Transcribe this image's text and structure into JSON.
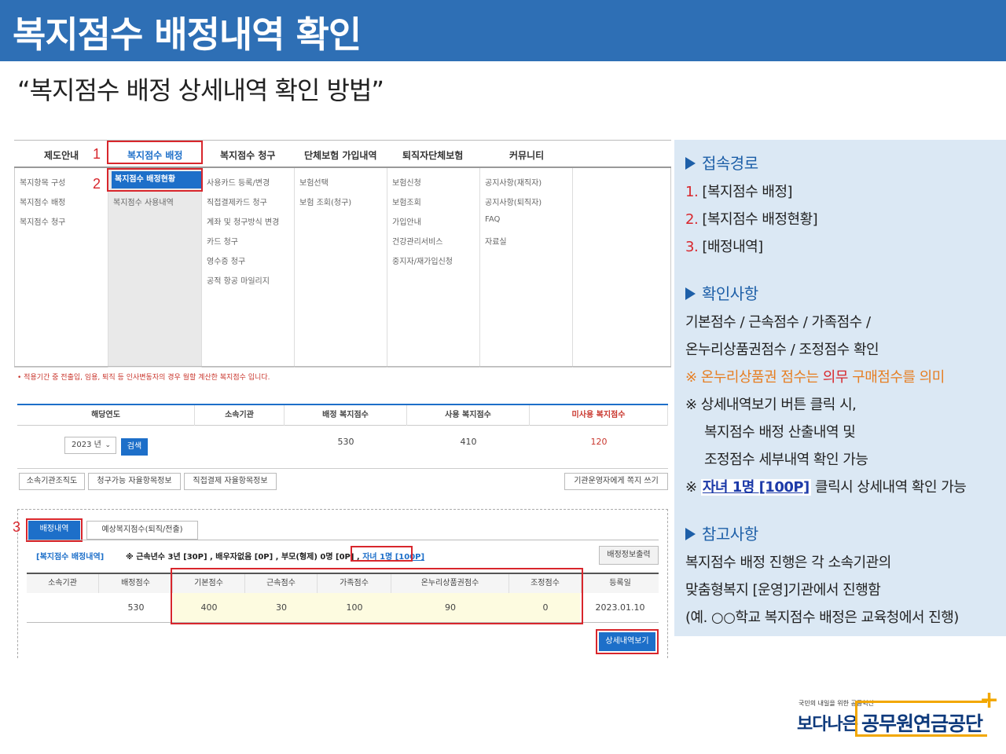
{
  "title": "복지점수 배정내역 확인",
  "subtitle": "“복지점수 배정 상세내역 확인 방법”",
  "screenshot": {
    "nav": [
      "제도안내",
      "복지점수 배정",
      "복지점수 청구",
      "단체보험 가입내역",
      "퇴직자단체보험",
      "커뮤니티"
    ],
    "step_numbers": [
      "1",
      "2",
      "3"
    ],
    "menu_col1": [
      "복지항목 구성",
      "복지점수 배정",
      "복지점수 청구"
    ],
    "menu_col2": [
      "복지점수 배정현황",
      "복지점수 사용내역"
    ],
    "menu_col3": [
      "사용카드 등록/변경",
      "직접결제카드 청구",
      "계좌 및 청구방식 변경",
      "카드 청구",
      "영수증 청구",
      "공적 항공 마일리지"
    ],
    "menu_col4": [
      "보험선택",
      "보험 조회(청구)"
    ],
    "menu_col5": [
      "보험신청",
      "보험조회",
      "가입안내",
      "건강관리서비스",
      "중지자/재가입신청"
    ],
    "menu_col6": [
      "공지사항(재직자)",
      "공지사항(퇴직자)",
      "FAQ",
      "자료실"
    ],
    "notice": "• 적용기간 중 전출입, 임용, 퇴직 등 인사변동자의 경우 월할 계산한 복지점수 입니다.",
    "year_table": {
      "headers": [
        "해당연도",
        "소속기관",
        "배정 복지점수",
        "사용 복지점수",
        "미사용 복지점수"
      ],
      "year": "2023 년",
      "search": "검색",
      "assigned": "530",
      "used": "410",
      "unused": "120"
    },
    "buttons": [
      "소속기관조직도",
      "청구가능 자율항목정보",
      "직접결제 자율항목정보",
      "기관운영자에게 쪽지 쓰기"
    ],
    "tabs": [
      "배정내역",
      "예상복지점수(퇴직/전출)"
    ],
    "info_label": "[복지점수 배정내역]",
    "info_text": "※ 근속년수 3년 [30P] , 배우자없음 [0P] , 부모(형제) 0명 [0P] ,",
    "info_link": "자녀 1명 [100P]",
    "print_btn": "배정정보출력",
    "detail_table": {
      "headers": [
        "소속기관",
        "배정점수",
        "기본점수",
        "근속점수",
        "가족점수",
        "온누리상품권점수",
        "조정점수",
        "등록일"
      ],
      "values": [
        "",
        "530",
        "400",
        "30",
        "100",
        "90",
        "0",
        "2023.01.10"
      ]
    },
    "detail_btn": "상세내역보기"
  },
  "panel": {
    "h1": "접속경로",
    "route": [
      {
        "num": "1.",
        "text": "[복지점수 배정]"
      },
      {
        "num": "2.",
        "text": "[복지점수 배정현황]"
      },
      {
        "num": "3.",
        "text": "[배정내역]"
      }
    ],
    "h2": "확인사항",
    "check1": "기본점수 / 근속점수 / 가족점수 /",
    "check2": "온누리상품권점수 / 조정점수 확인",
    "note1_a": "※ 온누리상품권 점수는 ",
    "note1_b": "의무",
    "note1_c": " 구매점수를 의미",
    "note2": "※ 상세내역보기 버튼 클릭 시,",
    "note2b": "복지점수 배정 산출내역 및",
    "note2c": "조정점수 세부내역 확인 가능",
    "note3_pre": "※",
    "note3_link": "자녀 1명 [100P]",
    "note3_post": "클릭시  상세내역 확인 가능",
    "h3": "참고사항",
    "ref1": "복지점수 배정 진행은 각 소속기관의",
    "ref2": "맞춤형복지 [운영]기관에서 진행함",
    "ref3": "(예. ○○학교 복지점수 배정은 교육청에서 진행)"
  },
  "logo": {
    "tagline": "국민의 내일을 위한 공공혁신",
    "brand1": "보다나은",
    "brand2": "공무원연금공단",
    "plus": "+"
  }
}
